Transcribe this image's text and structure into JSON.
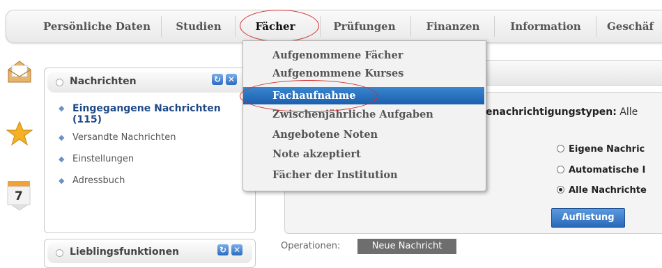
{
  "nav": {
    "tabs": [
      {
        "label": "Persönliche Daten"
      },
      {
        "label": "Studien"
      },
      {
        "label": "Fächer"
      },
      {
        "label": "Prüfungen"
      },
      {
        "label": "Finanzen"
      },
      {
        "label": "Information"
      },
      {
        "label": "Geschäf"
      }
    ],
    "active": "Fächer"
  },
  "dropdown": {
    "items": [
      {
        "label": "Aufgenommene Fächer"
      },
      {
        "label": "Aufgenommene Kurses"
      },
      {
        "label": "Fachaufnahme"
      },
      {
        "label": "Zwischenjährliche Aufgaben"
      },
      {
        "label": "Angebotene Noten"
      },
      {
        "label": "Note akzeptiert"
      },
      {
        "label": "Fächer der Institution"
      }
    ],
    "selected": "Fachaufnahme"
  },
  "messages_panel": {
    "title": "Nachrichten",
    "items": [
      {
        "label": "Eingegangene Nachrichten",
        "count": "(115)"
      },
      {
        "label": "Versandte Nachrichten"
      },
      {
        "label": "Einstellungen"
      },
      {
        "label": "Adressbuch"
      }
    ]
  },
  "favorites_panel": {
    "title": "Lieblingsfunktionen"
  },
  "calendar_icon": {
    "number": "7"
  },
  "filter": {
    "label_suffix": "enachrichtigungstypen:",
    "label_value": "Alle",
    "options": [
      {
        "label": "Eigene Nachric",
        "checked": false
      },
      {
        "label": "Automatische I",
        "checked": false
      },
      {
        "label": "Alle Nachrichte",
        "checked": true
      }
    ],
    "submit_label": "Auflistung"
  },
  "operations": {
    "label": "Operationen:",
    "new_message_label": "Neue Nachricht"
  },
  "colors": {
    "accent": "#2a68b8",
    "highlight_oval": "#d03030"
  }
}
